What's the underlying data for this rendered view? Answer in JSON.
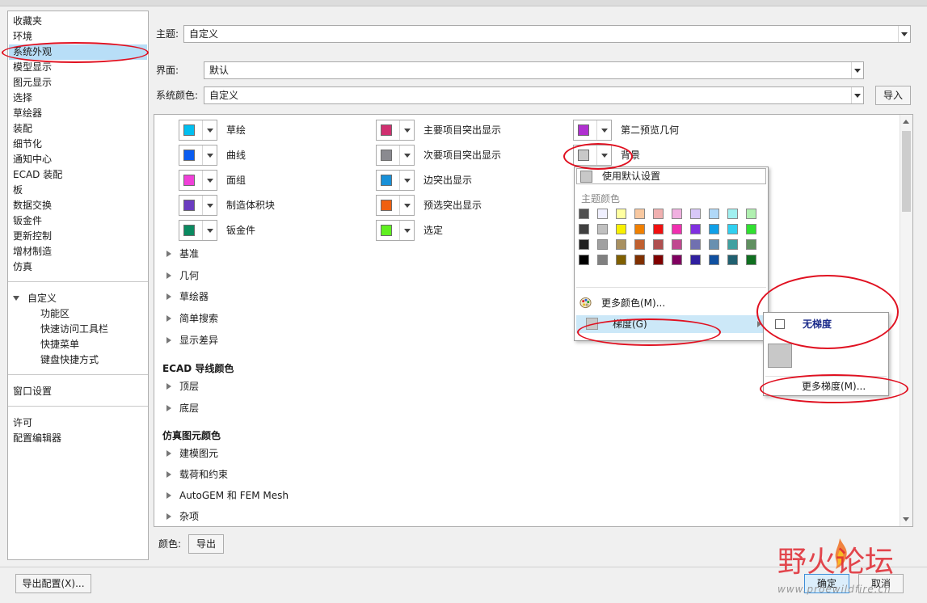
{
  "sidebar": {
    "items": [
      "收藏夹",
      "环境",
      "系统外观",
      "模型显示",
      "图元显示",
      "选择",
      "草绘器",
      "装配",
      "细节化",
      "通知中心",
      "ECAD 装配",
      "板",
      "数据交换",
      "钣金件",
      "更新控制",
      "增材制造",
      "仿真"
    ],
    "custom_group": "自定义",
    "custom_items": [
      "功能区",
      "快速访问工具栏",
      "快捷菜单",
      "键盘快捷方式"
    ],
    "window_settings": "窗口设置",
    "license": "许可",
    "config_editor": "配置编辑器"
  },
  "form": {
    "theme_label": "主题:",
    "theme_value": "自定义",
    "interface_label": "界面:",
    "interface_value": "默认",
    "syscolor_label": "系统颜色:",
    "syscolor_value": "自定义",
    "import_label": "导入"
  },
  "colors": {
    "col1": [
      {
        "label": "草绘",
        "color": "#00bff0"
      },
      {
        "label": "曲线",
        "color": "#0a5cf0"
      },
      {
        "label": "面组",
        "color": "#f040d8"
      },
      {
        "label": "制造体积块",
        "color": "#6a3cc0"
      },
      {
        "label": "钣金件",
        "color": "#0a8a60"
      }
    ],
    "col2": [
      {
        "label": "主要项目突出显示",
        "color": "#d03070"
      },
      {
        "label": "次要项目突出显示",
        "color": "#8a8a90"
      },
      {
        "label": "边突出显示",
        "color": "#1890d8"
      },
      {
        "label": "预选突出显示",
        "color": "#f06010"
      },
      {
        "label": "选定",
        "color": "#60f020"
      }
    ],
    "col3": [
      {
        "label": "第二预览几何",
        "color": "#b030d0"
      },
      {
        "label": "背景",
        "color": "#c8c8c8"
      }
    ]
  },
  "sections": {
    "expanders_a": [
      "基准",
      "几何",
      "草绘器",
      "简单搜索",
      "显示差异"
    ],
    "ecad_title": "ECAD 导线颜色",
    "ecad_items": [
      "顶层",
      "底层"
    ],
    "sim_title": "仿真图元颜色",
    "sim_items": [
      "建模图元",
      "载荷和约束",
      "AutoGEM 和 FEM Mesh",
      "杂项"
    ]
  },
  "popup": {
    "use_default": "使用默认设置",
    "theme_colors": "主题颜色",
    "palette": [
      [
        "#505050",
        "#f0f0ff",
        "#ffffa0",
        "#f8c8a0",
        "#f0b0b0",
        "#f0b0e0",
        "#d8c8f8",
        "#b0d8f8",
        "#a0f0f0",
        "#b0f0b0"
      ],
      [
        "#404040",
        "#c0c0c0",
        "#f8f000",
        "#f08000",
        "#f01010",
        "#f030b0",
        "#8030e0",
        "#10a0e8",
        "#30d0f0",
        "#30e030"
      ],
      [
        "#202020",
        "#a0a0a0",
        "#a89060",
        "#c06030",
        "#b05050",
        "#c04890",
        "#7070b0",
        "#6890b0",
        "#40a0a0",
        "#609060"
      ],
      [
        "#000000",
        "#808080",
        "#806000",
        "#803000",
        "#800000",
        "#800060",
        "#3020a0",
        "#1050a0",
        "#206070",
        "#107020"
      ]
    ],
    "more_colors": "更多颜色(M)...",
    "gradient": "梯度(G)"
  },
  "submenu": {
    "no_gradient": "无梯度",
    "more_gradients": "更多梯度(M)..."
  },
  "bottom": {
    "color_label": "颜色:",
    "export_label": "导出",
    "export_config": "导出配置(X)...",
    "ok": "确定",
    "cancel": "取消"
  },
  "watermark": {
    "brand": "野火论坛",
    "url": "www.proewildfire.cn"
  }
}
